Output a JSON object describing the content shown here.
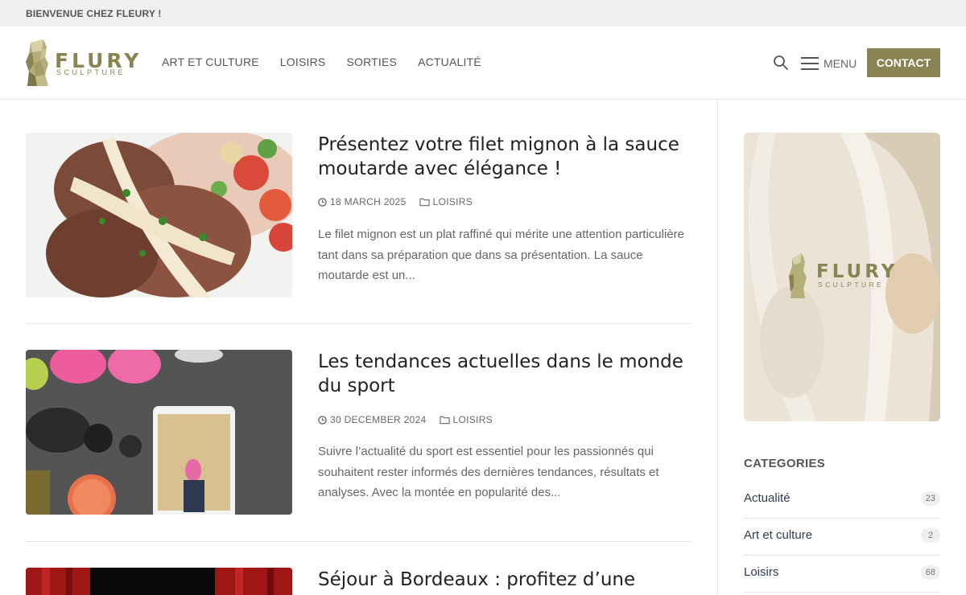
{
  "topbar": {
    "welcome": "BIENVENUE CHEZ FLEURY !"
  },
  "header": {
    "logo_word": "FLURY",
    "logo_sub": "SCULPTURE",
    "nav": [
      "ART ET CULTURE",
      "LOISIRS",
      "SORTIES",
      "ACTUALITÉ"
    ],
    "menu_label": "MENU",
    "contact_label": "CONTACT"
  },
  "posts": [
    {
      "title": "Présentez votre filet mignon à la sauce moutarde avec élégance !",
      "date": "18 MARCH 2025",
      "category": "LOISIRS",
      "excerpt": "Le filet mignon est un plat raffiné qui mérite une attention particulière tant dans sa préparation que dans sa présentation. La sauce moutarde est un..."
    },
    {
      "title": "Les tendances actuelles dans le monde du sport",
      "date": "30 DECEMBER 2024",
      "category": "LOISIRS",
      "excerpt": "Suivre l’actualité du sport est essentiel pour les passionnés qui souhaitent rester informés des dernières tendances, résultats et analyses. Avec la montée en popularité des..."
    },
    {
      "title": "Séjour à Bordeaux : profitez d’une sortie"
    }
  ],
  "sidebar": {
    "ad_logo_word": "FLURY",
    "ad_logo_sub": "SCULPTURE",
    "categories_title": "CATEGORIES",
    "categories": [
      {
        "name": "Actualité",
        "count": "23"
      },
      {
        "name": "Art et culture",
        "count": "2"
      },
      {
        "name": "Loisirs",
        "count": "68"
      }
    ]
  },
  "colors": {
    "accent": "#8a8354",
    "topbar": "#f0f0f0"
  }
}
